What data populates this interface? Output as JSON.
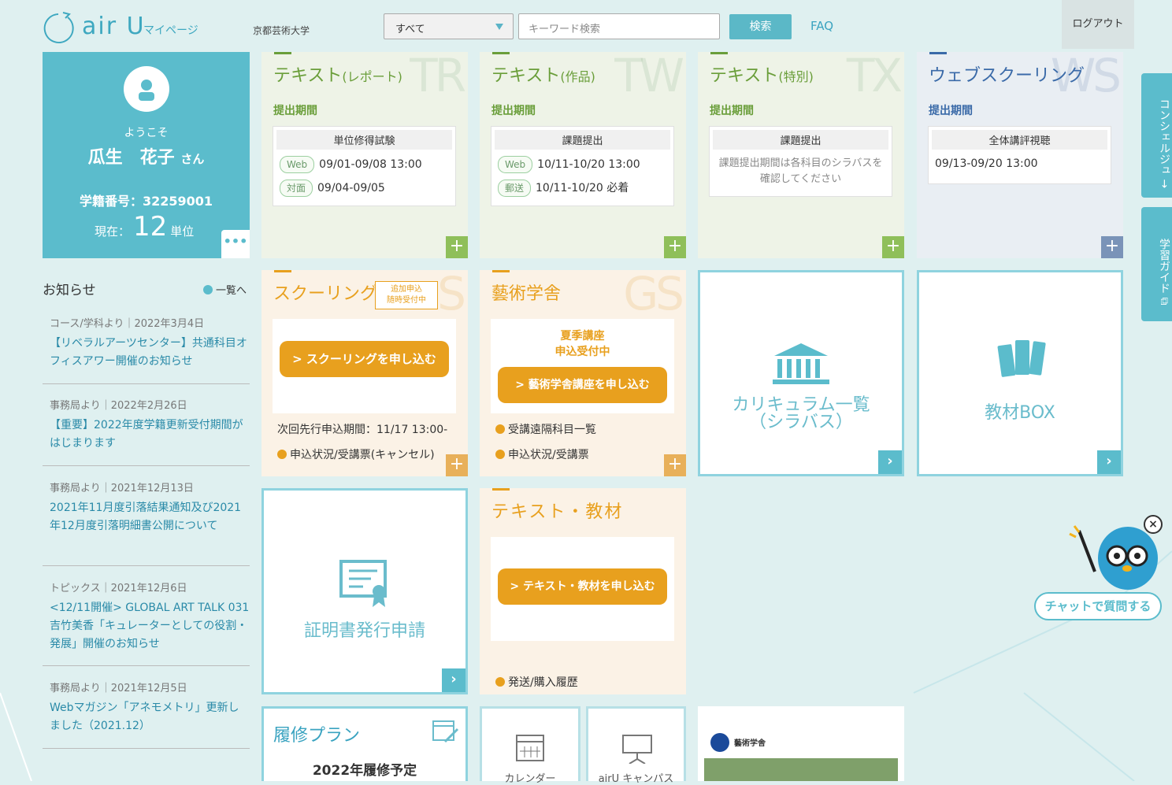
{
  "header": {
    "logo_text": "air U",
    "logo_sub": "マイページ",
    "university": "京都芸術大学",
    "search_select": "すべて",
    "search_placeholder": "キーワード検索",
    "search_button": "検索",
    "faq": "FAQ",
    "logout": "ログアウト"
  },
  "profile": {
    "welcome": "ようこそ",
    "name": "瓜生　花子",
    "honorific": "さん",
    "student_id": "学籍番号：32259001",
    "current_label": "現在：",
    "credits": "12",
    "credits_unit": "単位",
    "more": "•••"
  },
  "news": {
    "heading": "お知らせ",
    "all_link": "一覧へ",
    "items": [
      {
        "meta": "コース/学科より｜2022年3月4日",
        "title": "【リベラルアーツセンター】共通科目オフィスアワー開催のお知らせ"
      },
      {
        "meta": "事務局より｜2022年2月26日",
        "title": "【重要】2022年度学籍更新受付期間がはじまります"
      },
      {
        "meta": "事務局より｜2021年12月13日",
        "title": "2021年11月度引落結果通知及び2021年12月度引落明細書公開について"
      },
      {
        "meta": "トピックス｜2021年12月6日",
        "title": "<12/11開催> GLOBAL ART TALK 031 吉竹美香「キュレーターとしての役割・発展」開催のお知らせ"
      },
      {
        "meta": "事務局より｜2021年12月5日",
        "title": "Webマガジン「アネモメトリ」更新しました（2021.12）"
      }
    ]
  },
  "cards": {
    "report": {
      "title": "テキスト",
      "title_sub": "(レポート)",
      "bg": "TR",
      "period": "提出期間",
      "box_head": "単位修得試験",
      "rows": [
        {
          "tag": "Web",
          "text": "09/01-09/08 13:00"
        },
        {
          "tag": "対面",
          "text": "09/04-09/05"
        }
      ]
    },
    "work": {
      "title": "テキスト",
      "title_sub": "(作品)",
      "bg": "TW",
      "period": "提出期間",
      "box_head": "課題提出",
      "rows": [
        {
          "tag": "Web",
          "text": "10/11-10/20 13:00"
        },
        {
          "tag": "郵送",
          "text": "10/11-10/20 必着"
        }
      ]
    },
    "special": {
      "title": "テキスト",
      "title_sub": "(特別)",
      "bg": "TX",
      "period": "提出期間",
      "box_head": "課題提出",
      "note": "課題提出期間は各科目のシラバスを確認してください"
    },
    "web": {
      "title": "ウェブスクーリング",
      "bg": "WS",
      "period": "提出期間",
      "box_head": "全体講評視聴",
      "row": "09/13-09/20 13:00"
    },
    "schooling": {
      "title": "スクーリング",
      "badge1": "追加申込",
      "badge2": "随時受付中",
      "bg": "S",
      "button": "> スクーリングを申し込む",
      "next": "次回先行申込期間：11/17 13:00-",
      "link": "申込状況/受講票(キャンセル)"
    },
    "gakusha": {
      "title": "藝術学舎",
      "bg": "GS",
      "line1": "夏季講座",
      "line2": "申込受付中",
      "button": "> 藝術学舎講座を申し込む",
      "link1": "受講遠隔科目一覧",
      "link2": "申込状況/受講票"
    },
    "curriculum": {
      "label": "カリキュラム一覧",
      "label2": "（シラバス）"
    },
    "box": {
      "label": "教材BOX"
    },
    "cert": {
      "label": "証明書発行申請"
    },
    "text_material": {
      "title": "テキスト・教材",
      "button": "> テキスト・教材を申し込む",
      "link": "発送/購入履歴"
    },
    "plan": {
      "title": "履修プラン",
      "year": "2022年履修予定"
    },
    "calendar": {
      "label": "カレンダー"
    },
    "campus": {
      "label": "airU キャンパス"
    },
    "banner": {
      "label": "藝術学舎"
    }
  },
  "side": {
    "concierge": "コンシェルジュ →",
    "guide": "学習ガイド ⧉"
  },
  "chat": {
    "button": "チャットで質問する",
    "close": "×"
  },
  "colors": {
    "accent": "#5bbccc",
    "orange": "#e8a01e",
    "green": "#6a9e3a"
  }
}
